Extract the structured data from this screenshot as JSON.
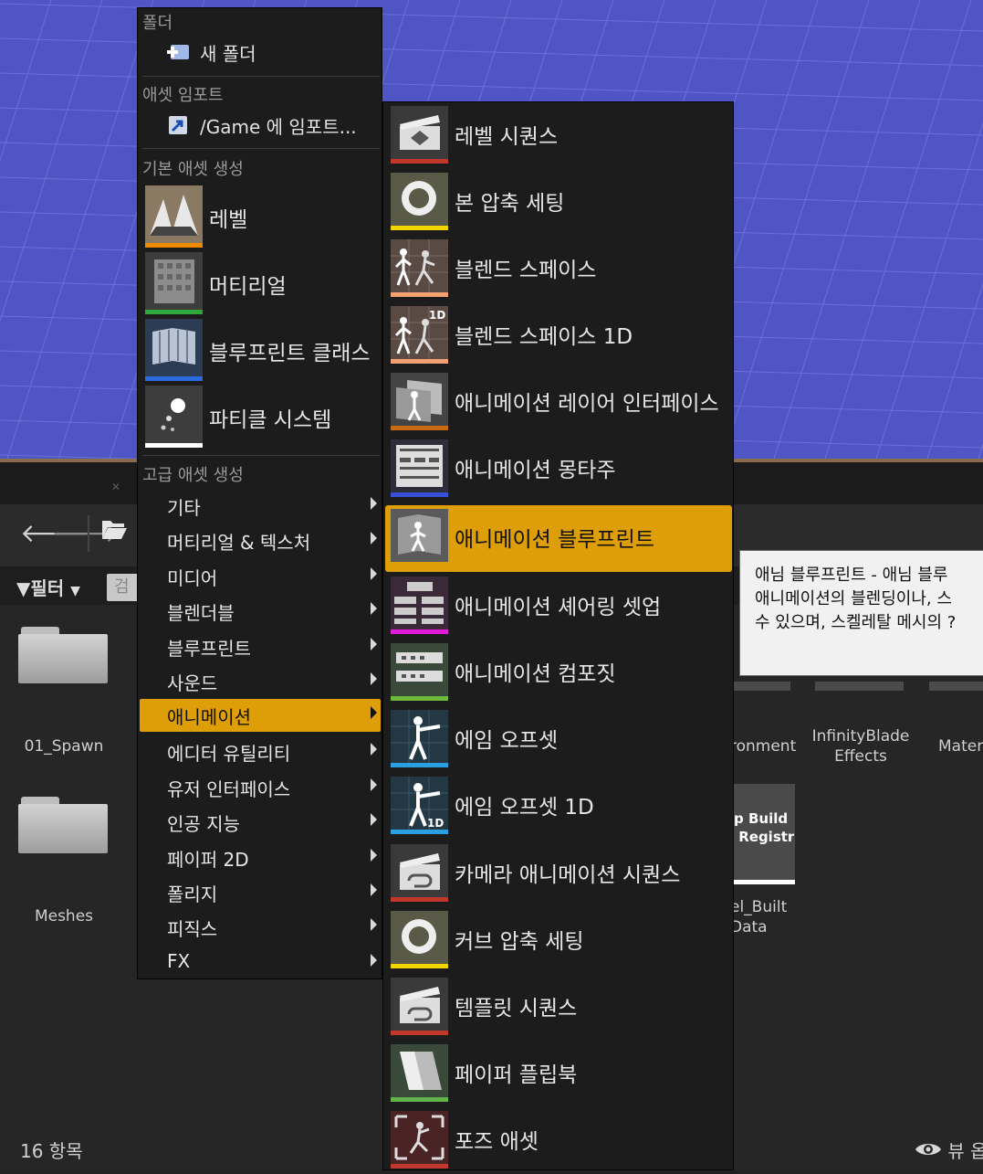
{
  "menu": {
    "sections": {
      "folder": "폴더",
      "import": "애셋 임포트",
      "basic": "기본 애셋 생성",
      "advanced": "고급 애셋 생성"
    },
    "new_folder": "새 폴더",
    "import_to": "/Game 에 임포트...",
    "basic_items": [
      {
        "label": "레벨",
        "icon": "level-icon",
        "color": "#f08a00"
      },
      {
        "label": "머티리얼",
        "icon": "material-icon",
        "color": "#2faa3a"
      },
      {
        "label": "블루프린트 클래스",
        "icon": "blueprint-icon",
        "color": "#2a6be0"
      },
      {
        "label": "파티클 시스템",
        "icon": "particle-system-icon",
        "color": "#ffffff"
      }
    ],
    "advanced_items": [
      {
        "label": "기타"
      },
      {
        "label": "머티리얼 & 텍스처"
      },
      {
        "label": "미디어"
      },
      {
        "label": "블렌더블"
      },
      {
        "label": "블루프린트"
      },
      {
        "label": "사운드"
      },
      {
        "label": "애니메이션",
        "active": true
      },
      {
        "label": "에디터 유틸리티"
      },
      {
        "label": "유저 인터페이스"
      },
      {
        "label": "인공 지능"
      },
      {
        "label": "페이퍼 2D"
      },
      {
        "label": "폴리지"
      },
      {
        "label": "피직스"
      },
      {
        "label": "FX"
      }
    ]
  },
  "submenu": {
    "items": [
      {
        "label": "레벨 시퀀스",
        "icon": "level-sequence-icon",
        "color": "#c0392b"
      },
      {
        "label": "본 압축 세팅",
        "icon": "bone-compression-icon",
        "color": "#f2d500"
      },
      {
        "label": "블렌드 스페이스",
        "icon": "blend-space-icon",
        "color": "#f5a070"
      },
      {
        "label": "블렌드 스페이스 1D",
        "icon": "blend-space-1d-icon",
        "color": "#f5a070"
      },
      {
        "label": "애니메이션 레이어 인터페이스",
        "icon": "anim-layer-interface-icon",
        "color": "#c96a10"
      },
      {
        "label": "애니메이션 몽타주",
        "icon": "anim-montage-icon",
        "color": "#3a4fd8"
      },
      {
        "label": "애니메이션 블루프린트",
        "icon": "anim-blueprint-icon",
        "color": "#dd9e08",
        "active": true
      },
      {
        "label": "애니메이션 셰어링 셋업",
        "icon": "anim-sharing-setup-icon",
        "color": "#e11bd8"
      },
      {
        "label": "애니메이션 컴포짓",
        "icon": "anim-composite-icon",
        "color": "#6dbb3a"
      },
      {
        "label": "에임 오프셋",
        "icon": "aim-offset-icon",
        "color": "#2aa0e0"
      },
      {
        "label": "에임 오프셋 1D",
        "icon": "aim-offset-1d-icon",
        "color": "#2aa0e0"
      },
      {
        "label": "카메라 애니메이션 시퀀스",
        "icon": "camera-anim-sequence-icon",
        "color": "#c0392b"
      },
      {
        "label": "커브 압축 세팅",
        "icon": "curve-compression-icon",
        "color": "#f2d500"
      },
      {
        "label": "템플릿 시퀀스",
        "icon": "template-sequence-icon",
        "color": "#c0392b"
      },
      {
        "label": "페이퍼 플립북",
        "icon": "paper-flipbook-icon",
        "color": "#62b44a"
      },
      {
        "label": "포즈 애셋",
        "icon": "pose-asset-icon",
        "color": "#c0392b"
      }
    ]
  },
  "tooltip": {
    "line1": "애님 블루프린트 - 애님 블루",
    "line2": "애니메이션의 블렌딩이나, 스",
    "line3": "수 있으며, 스켈레탈 메시의 ?"
  },
  "browser": {
    "filter_label": "필터",
    "search_placeholder": "검",
    "assets": {
      "spawn": "01_Spawn",
      "meshes": "Meshes",
      "environment": "ronment",
      "infinity_line1": "InfinityBlade",
      "infinity_line2": "Effects",
      "materials": "Mater",
      "built_data_line1": "el_Built",
      "built_data_line2": "Data",
      "registry": "p Build\n Registry"
    },
    "item_count": "16 항목",
    "view_options": "뷰 옵"
  }
}
